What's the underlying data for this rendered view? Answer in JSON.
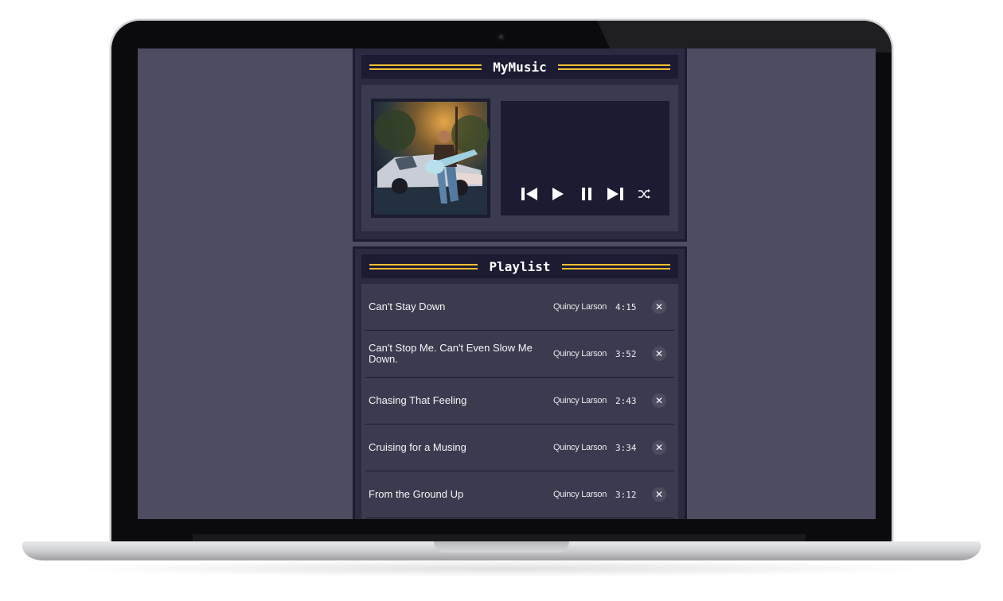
{
  "app": {
    "title": "MyMusic",
    "playlist_title": "Playlist"
  },
  "player": {
    "album_art_alt": "song cover art",
    "controls": [
      {
        "name": "previous-button",
        "icon": "previous-icon"
      },
      {
        "name": "play-button",
        "icon": "play-icon"
      },
      {
        "name": "pause-button",
        "icon": "pause-icon"
      },
      {
        "name": "next-button",
        "icon": "next-icon"
      },
      {
        "name": "shuffle-button",
        "icon": "shuffle-icon"
      }
    ]
  },
  "playlist": [
    {
      "title": "Can't Stay Down",
      "artist": "Quincy Larson",
      "duration": "4:15"
    },
    {
      "title": "Can't Stop Me. Can't Even Slow Me Down.",
      "artist": "Quincy Larson",
      "duration": "3:52"
    },
    {
      "title": "Chasing That Feeling",
      "artist": "Quincy Larson",
      "duration": "2:43"
    },
    {
      "title": "Cruising for a Musing",
      "artist": "Quincy Larson",
      "duration": "3:34"
    },
    {
      "title": "From the Ground Up",
      "artist": "Quincy Larson",
      "duration": "3:12"
    }
  ],
  "delete_symbol": "✕",
  "colors": {
    "background": "#4d4c61",
    "panel": "#2a2a40",
    "panel_border": "#1b1b32",
    "accent": "#f1be32",
    "content": "#3b3b4f"
  }
}
